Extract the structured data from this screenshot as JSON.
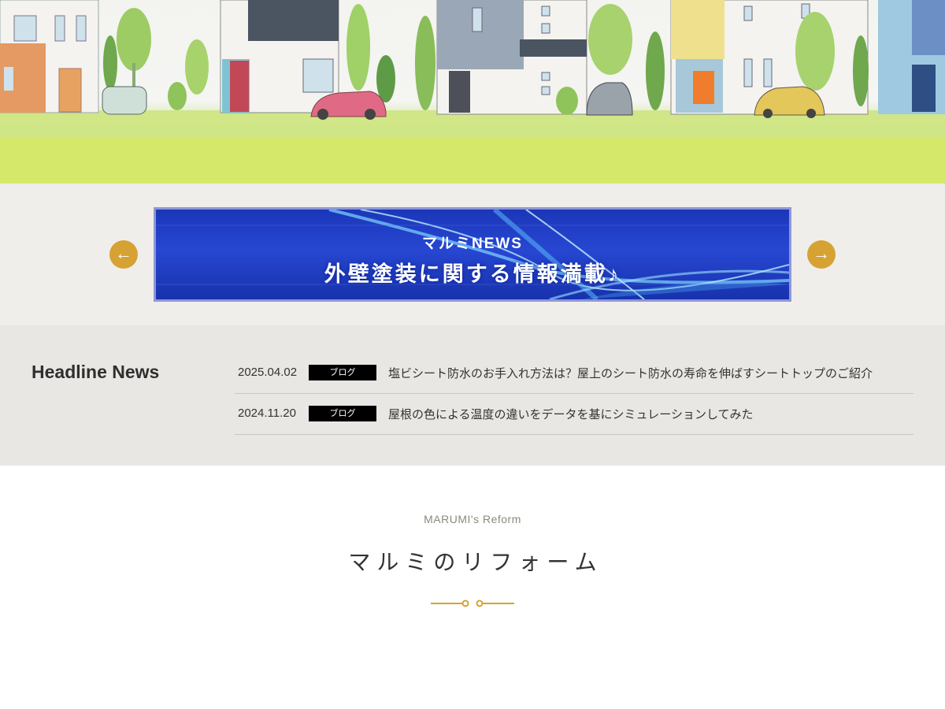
{
  "banner": {
    "subtitle": "マルミNEWS",
    "title": "外壁塗装に関する情報満載♪",
    "prev_icon": "arrow-left-icon",
    "next_icon": "arrow-right-icon",
    "prev_glyph": "←",
    "next_glyph": "→"
  },
  "news": {
    "heading": "Headline News",
    "items": [
      {
        "date": "2025.04.02",
        "category": "ブログ",
        "title": "塩ビシート防水のお手入れ方法は？屋上のシート防水の寿命を伸ばすシートトップのご紹介"
      },
      {
        "date": "2024.11.20",
        "category": "ブログ",
        "title": "屋根の色による温度の違いをデータを基にシミュレーションしてみた"
      }
    ]
  },
  "reform": {
    "subtitle": "MARUMI's Reform",
    "title": "マルミのリフォーム"
  },
  "colors": {
    "accent": "#d6a233",
    "banner_blue": "#2747d2",
    "news_bg": "#e9e7e3",
    "banner_bg": "#f0eeeb"
  }
}
